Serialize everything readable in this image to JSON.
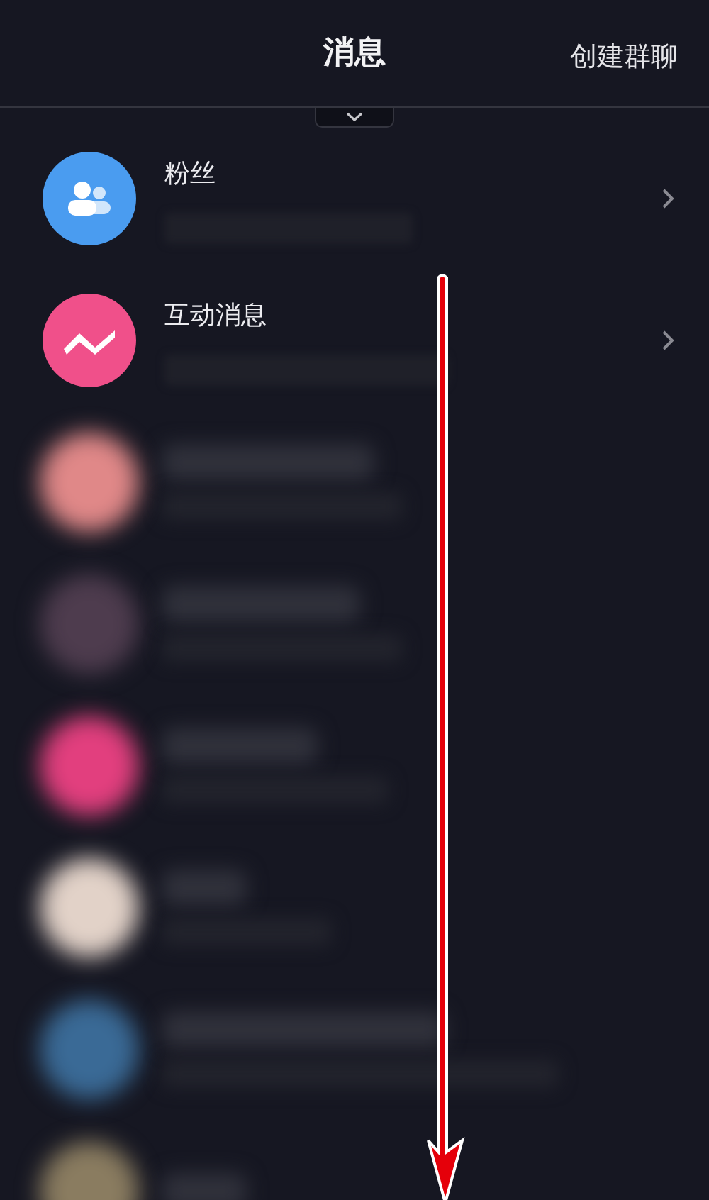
{
  "header": {
    "title": "消息",
    "action": "创建群聊"
  },
  "system_entries": [
    {
      "kind": "fans",
      "title": "粉丝",
      "color": "#4a9cf0"
    },
    {
      "kind": "interaction",
      "title": "互动消息",
      "color": "#f0508a"
    }
  ],
  "blurred_conversations": [
    {
      "color": "#e08888"
    },
    {
      "color": "#4e3c4e"
    },
    {
      "color": "#e23f7e"
    },
    {
      "color": "#e2d2c8"
    },
    {
      "color": "#3a6a96"
    },
    {
      "color": "#8a7c60"
    }
  ]
}
